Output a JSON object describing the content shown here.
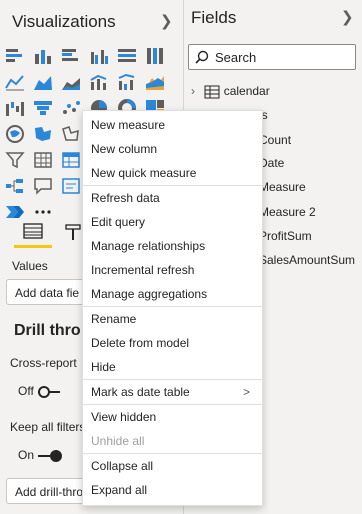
{
  "visualizations": {
    "title": "Visualizations"
  },
  "fields_pane": {
    "title": "Fields"
  },
  "search": {
    "placeholder": "Search"
  },
  "fields": {
    "table_name": "calendar",
    "items": [
      "ls",
      "Count",
      "Date",
      "Measure",
      "Measure 2",
      "ProfitSum",
      "SalesAmountSum"
    ]
  },
  "build": {
    "values_label": "Values",
    "add_data_fields": "Add data fie",
    "drill_through_heading": "Drill thro",
    "cross_report_label": "Cross-report",
    "cross_report_state": "Off",
    "keep_all_filters_label": "Keep all filters",
    "keep_all_filters_state": "On",
    "add_drill_through": "Add drill-thro"
  },
  "context_menu": {
    "items": [
      "New measure",
      "New column",
      "New quick measure",
      "Refresh data",
      "Edit query",
      "Manage relationships",
      "Incremental refresh",
      "Manage aggregations",
      "Rename",
      "Delete from model",
      "Hide",
      "Mark as date table",
      "View hidden",
      "Unhide all",
      "Collapse all",
      "Expand all"
    ],
    "submenu_glyph": ">",
    "more_glyph": "..."
  },
  "colors": {
    "accent": "#2b88d8",
    "yellow": "#f2c811",
    "background": "#f3f2f1",
    "disabled": "#a19f9d"
  }
}
